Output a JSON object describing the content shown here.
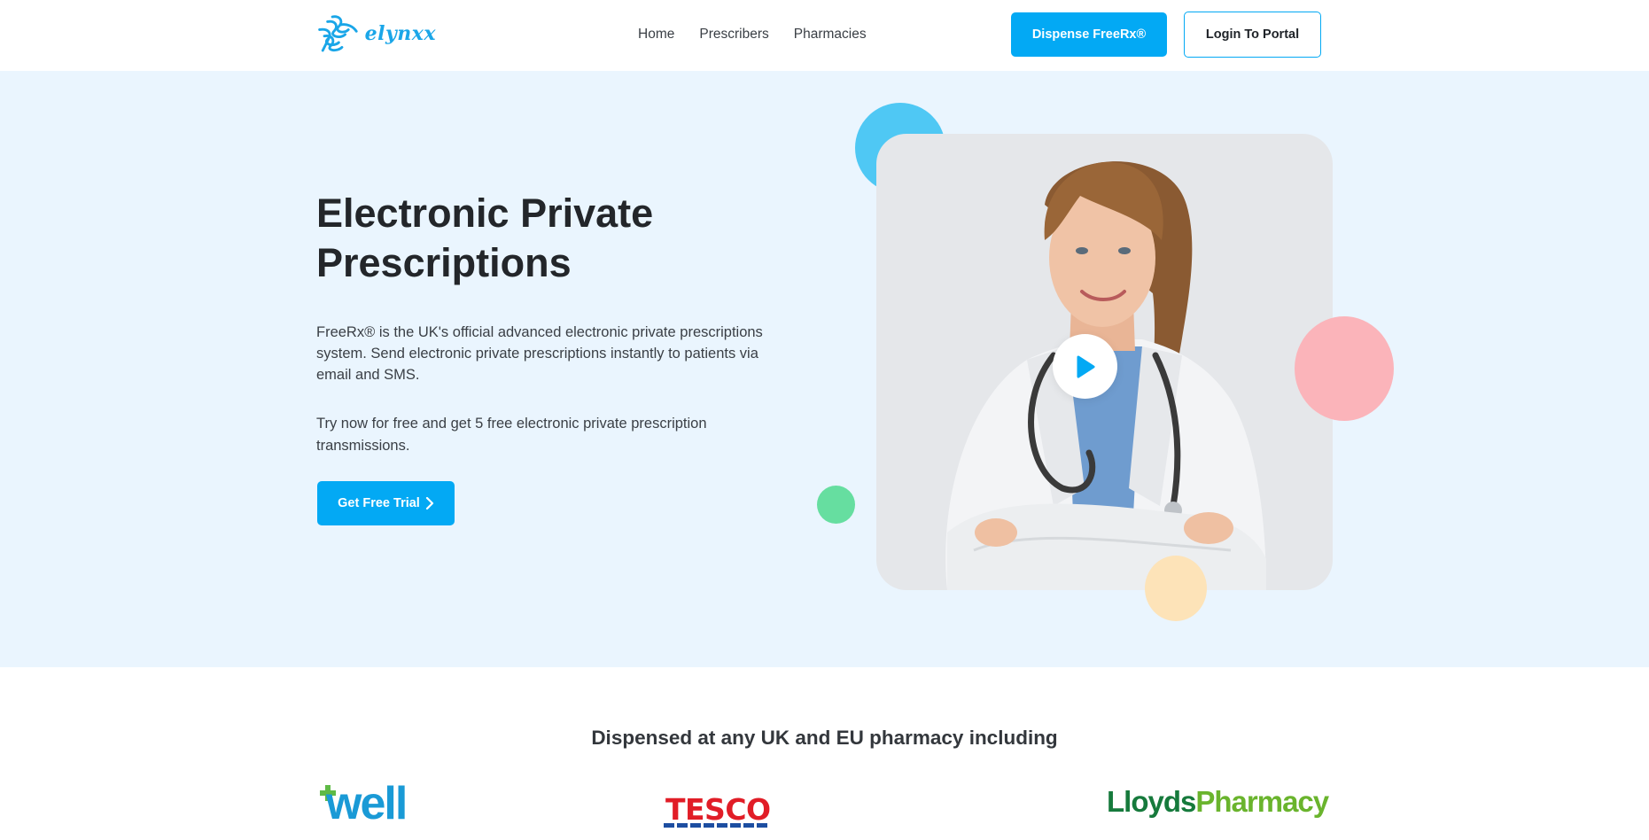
{
  "header": {
    "logo_text": "elynxx",
    "nav": [
      {
        "label": "Home"
      },
      {
        "label": "Prescribers"
      },
      {
        "label": "Pharmacies"
      }
    ],
    "dispense_label": "Dispense FreeRx®",
    "login_label": "Login To Portal"
  },
  "hero": {
    "title_line1": "Electronic Private",
    "title_line2": "Prescriptions",
    "description": "FreeRx® is the UK's official advanced electronic private prescriptions system. Send electronic private prescriptions instantly to patients via email and SMS.",
    "trial_text": "Try now for free and get 5 free electronic private prescription transmissions.",
    "trial_button_label": "Get Free Trial",
    "trial_button_icon": "chevron-right-icon",
    "video_icon": "play-icon"
  },
  "partners": {
    "heading": "Dispensed at any UK and EU pharmacy including",
    "logos": [
      {
        "name": "well",
        "text": "well"
      },
      {
        "name": "tesco",
        "text": "TESCO"
      },
      {
        "name": "lloyds",
        "text_a": "Lloyds",
        "text_b": "Pharmacy"
      }
    ]
  },
  "colors": {
    "accent": "#03a9f4",
    "hero_bg": "#eaf5fe",
    "deco_blue": "#4fc8f4",
    "deco_pink": "#fbb4ba",
    "deco_green": "#66dea0",
    "deco_peach": "#fde3b8"
  }
}
